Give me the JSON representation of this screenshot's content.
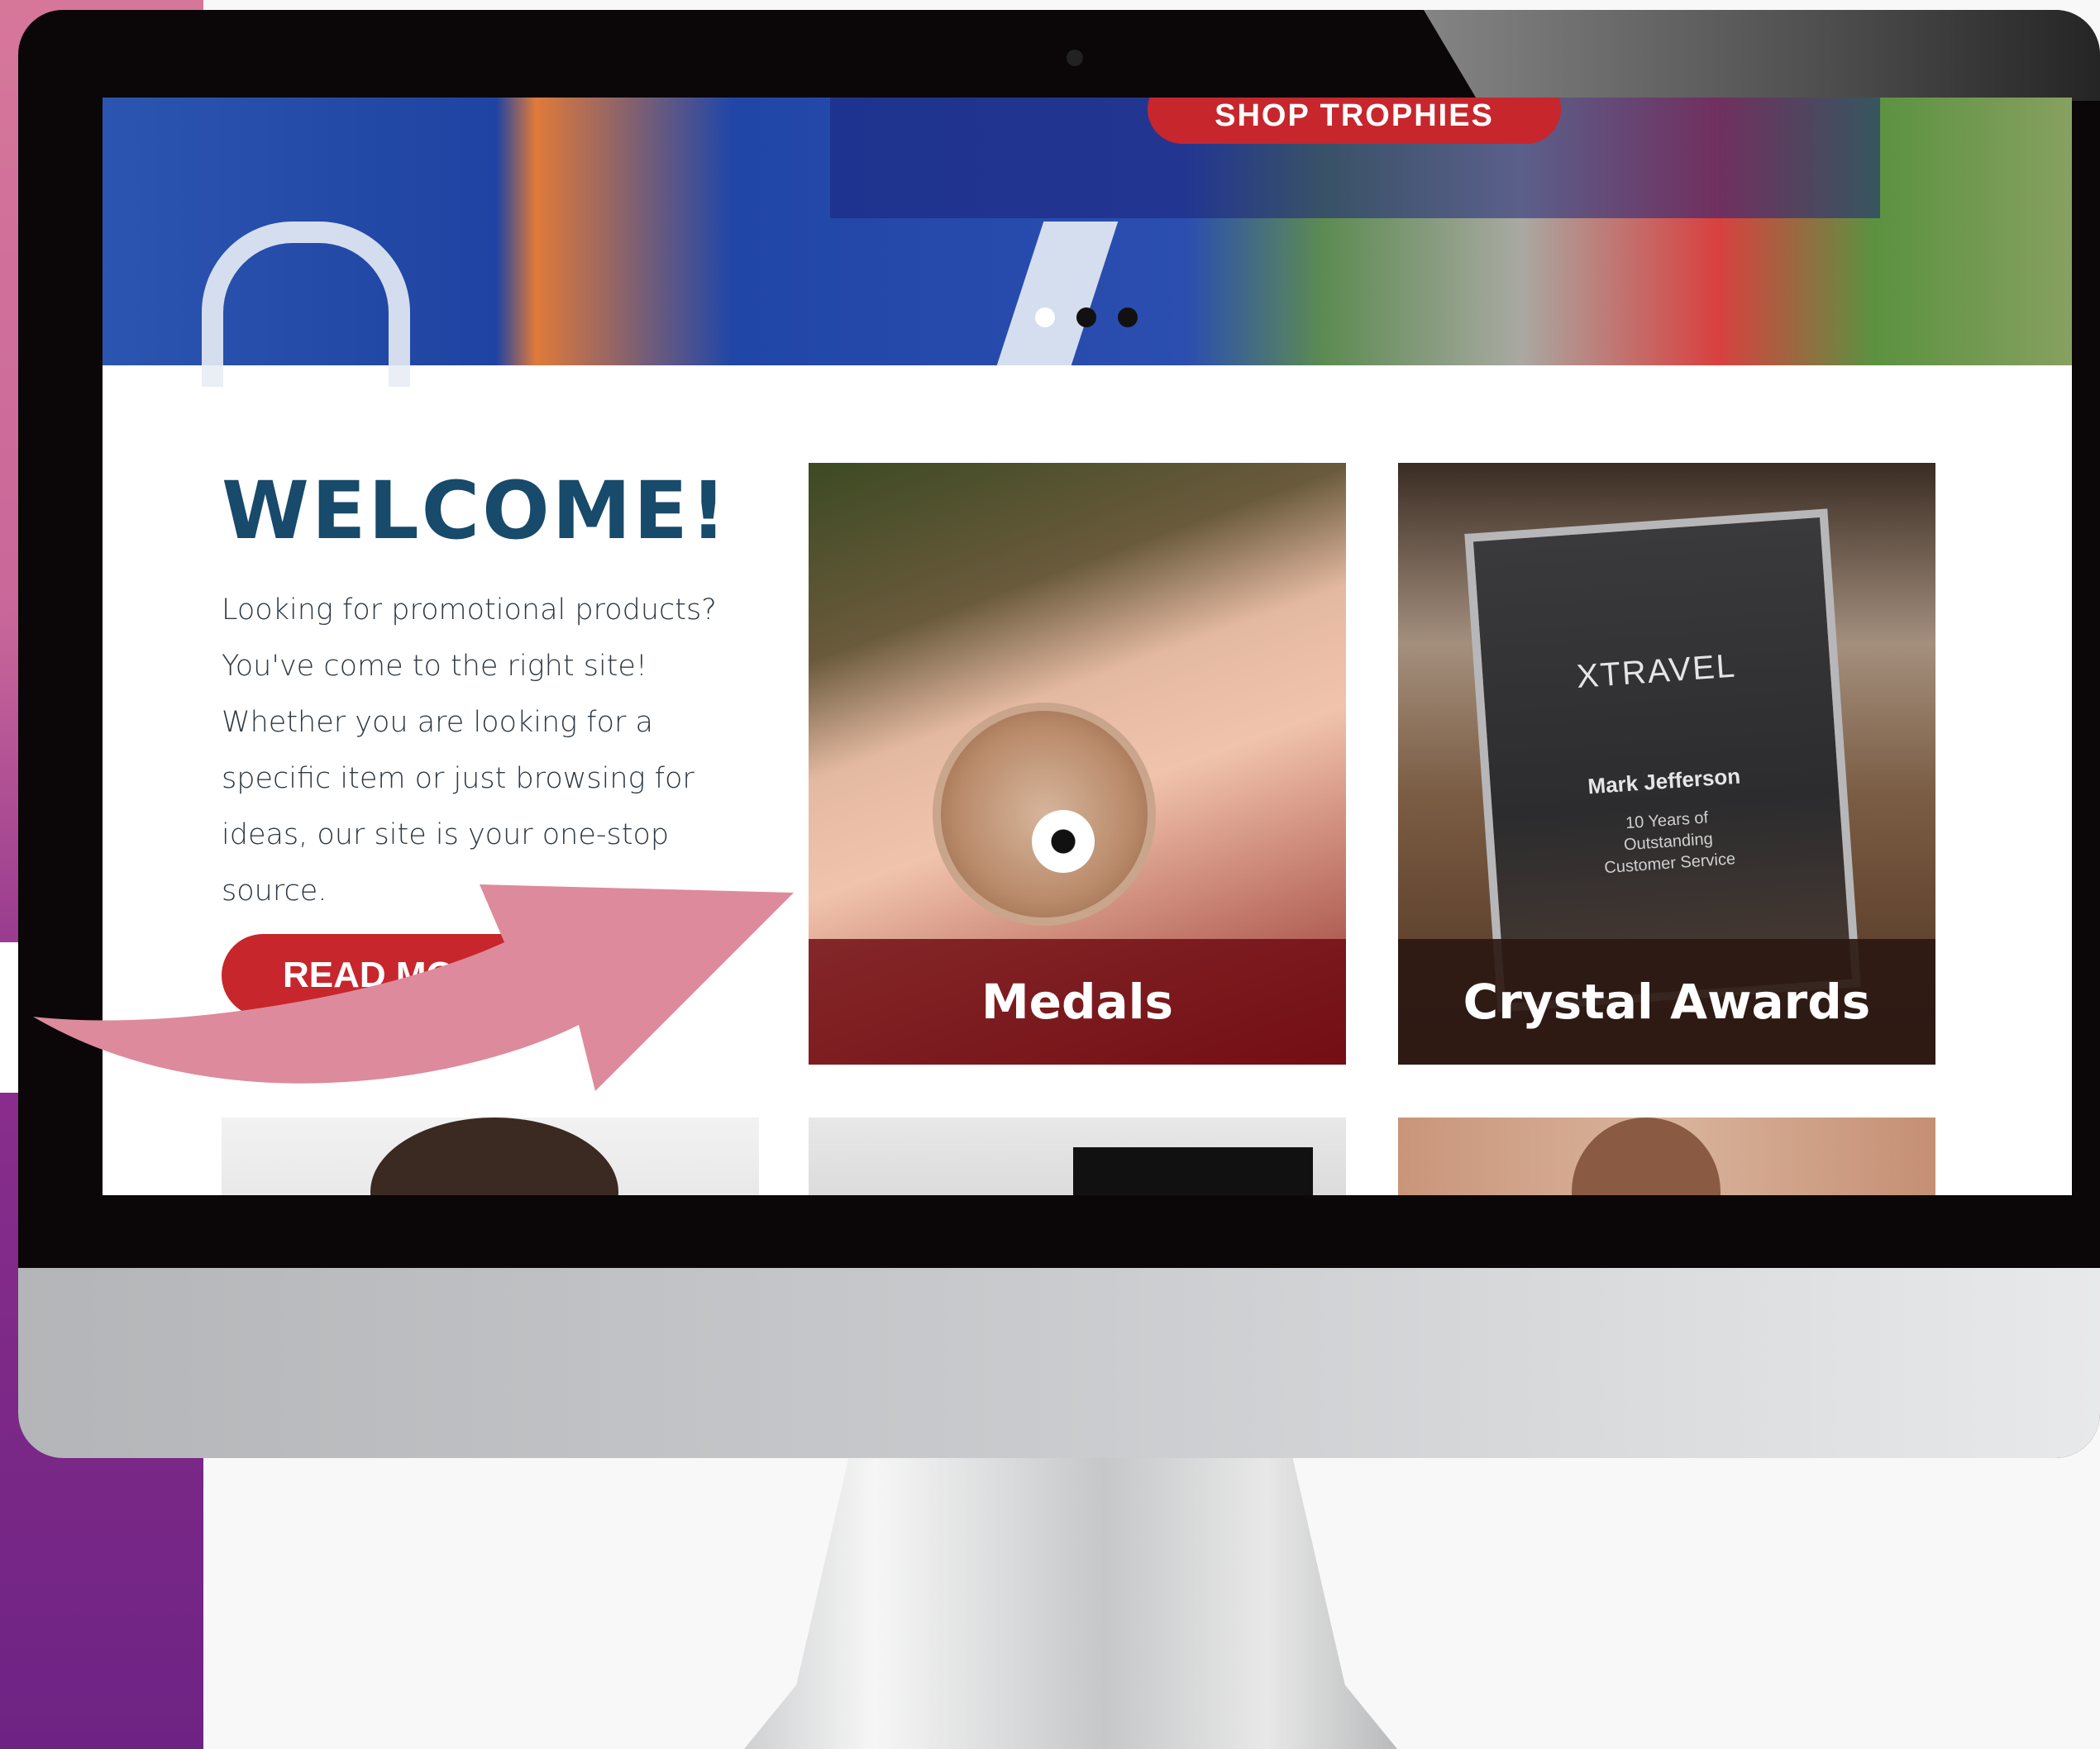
{
  "hero": {
    "cta_label": "SHOP TROPHIES",
    "slide_count": 3,
    "active_slide": 1
  },
  "welcome": {
    "heading": "WELCOME!",
    "body": "Looking for promotional products? You've come to the right site! Whether you are looking for a specific item or just browsing for ideas, our site is your one-stop source.",
    "button_label": "READ MORE"
  },
  "tiles": [
    {
      "label": "Medals"
    },
    {
      "label": "Crystal Awards"
    }
  ],
  "plaque": {
    "logo": "XTRAVEL",
    "name": "Mark Jefferson",
    "subtitle": "10 Years of\nOutstanding\nCustomer Service"
  },
  "colors": {
    "accent_red": "#c7262d",
    "heading_blue": "#174a6b",
    "arrow_pink": "#dd8a9c",
    "background_purple": "#6e2384"
  },
  "icons": [
    "soccer-ball-icon",
    "arrow-icon",
    "webcam-icon"
  ]
}
